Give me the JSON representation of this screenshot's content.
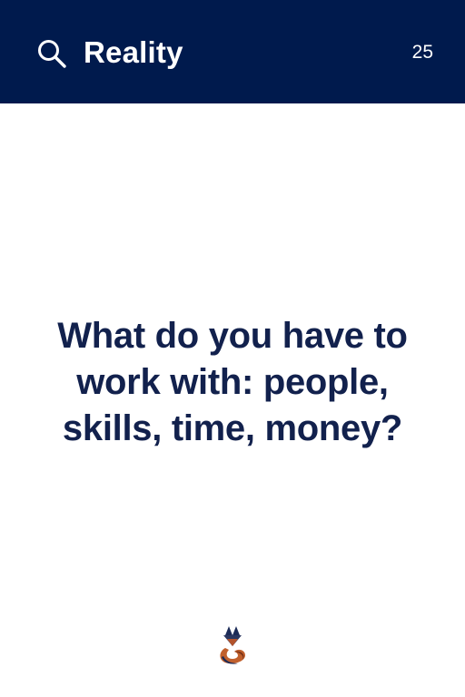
{
  "header": {
    "title": "Reality",
    "card_number": "25",
    "icon": "search-icon",
    "background_color": "#001a4d",
    "text_color": "#ffffff"
  },
  "main": {
    "question": "What do you have to work with: people, skills, time, money?",
    "text_color": "#12214d"
  },
  "footer": {
    "logo_icon": "fox-logo-icon"
  }
}
